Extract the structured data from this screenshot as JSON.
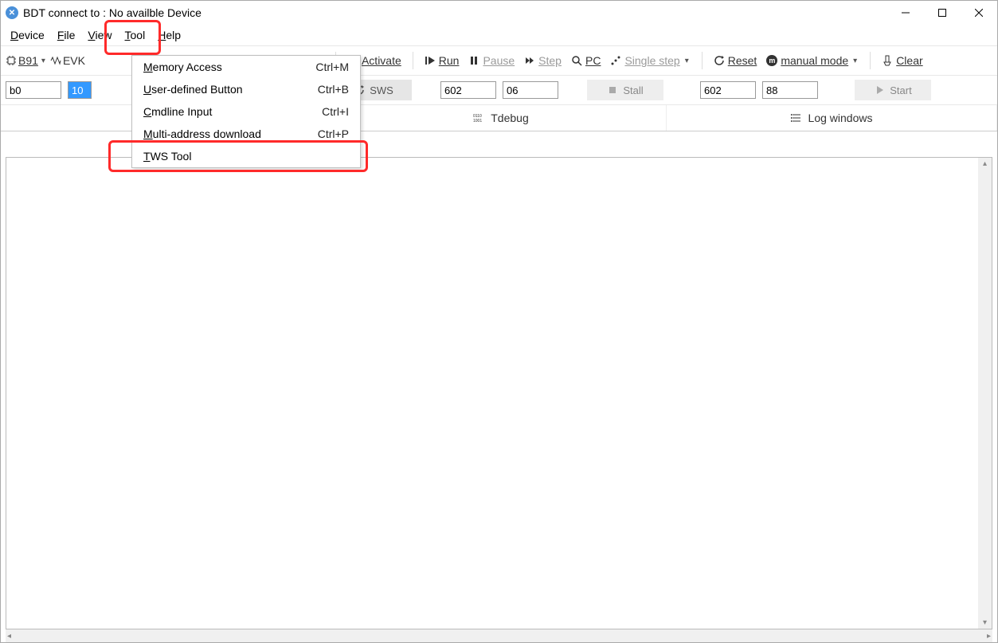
{
  "title": "BDT connect to : No availble Device",
  "menubar": {
    "device": "Device",
    "file": "File",
    "view": "View",
    "tool": "Tool",
    "help": "Help"
  },
  "toolbar": {
    "chip": "B91",
    "evk": "EVK",
    "activate": "Activate",
    "run": "Run",
    "pause": "Pause",
    "step": "Step",
    "pc": "PC",
    "single_step": "Single step",
    "reset": "Reset",
    "manual_mode": "manual mode",
    "clear": "Clear"
  },
  "row2": {
    "addr": "b0",
    "count": "10",
    "sws": "SWS",
    "f1": "602",
    "f2": "06",
    "stall": "Stall",
    "f3": "602",
    "f4": "88",
    "start": "Start"
  },
  "tabs": {
    "tdebug": "Tdebug",
    "logwin": "Log windows"
  },
  "dropdown": {
    "items": [
      {
        "label": "Memory Access",
        "shortcut": "Ctrl+M"
      },
      {
        "label": "User-defined Button",
        "shortcut": "Ctrl+B"
      },
      {
        "label": "Cmdline Input",
        "shortcut": "Ctrl+I"
      },
      {
        "label": "Multi-address download",
        "shortcut": "Ctrl+P"
      },
      {
        "label": "TWS Tool",
        "shortcut": ""
      }
    ]
  }
}
